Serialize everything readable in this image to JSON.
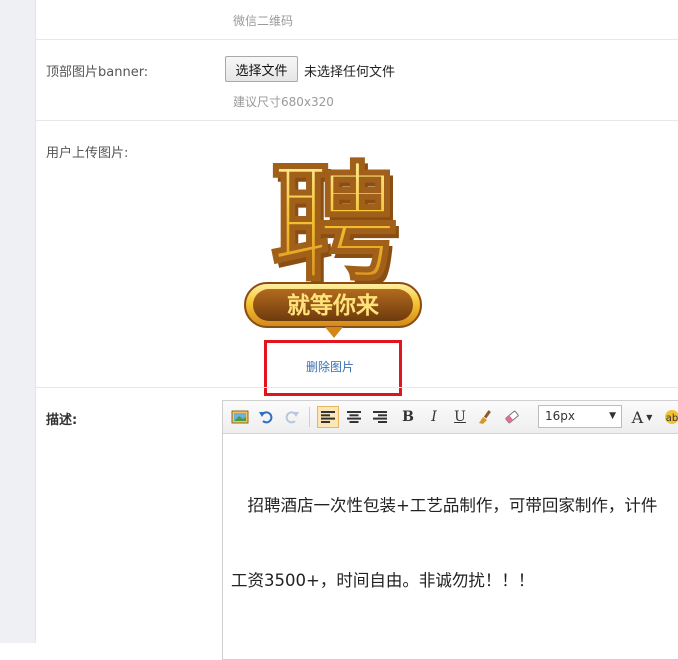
{
  "qr_row": {
    "hint": "微信二维码"
  },
  "banner_row": {
    "label": "顶部图片banner:",
    "file_button": "选择文件",
    "file_status": "未选择任何文件",
    "hint": "建议尺寸680x320"
  },
  "upload_row": {
    "label": "用户上传图片:",
    "image_text_main": "聘",
    "image_text_banner": "就等你来",
    "delete_link": "删除图片"
  },
  "description_row": {
    "label": "描述:",
    "toolbar": {
      "font_size": "16px",
      "bold": "B",
      "italic": "I",
      "underline": "U",
      "font_color": "A"
    },
    "content_lines": [
      "　招聘酒店一次性包装+工艺品制作，可带回家制作，计件",
      "工资3500+，时间自由。非诚勿扰！！！"
    ]
  },
  "colors": {
    "delete_link": "#3a6fb0",
    "highlight_box": "#e0161c",
    "image_gold": "#f2b51c"
  }
}
